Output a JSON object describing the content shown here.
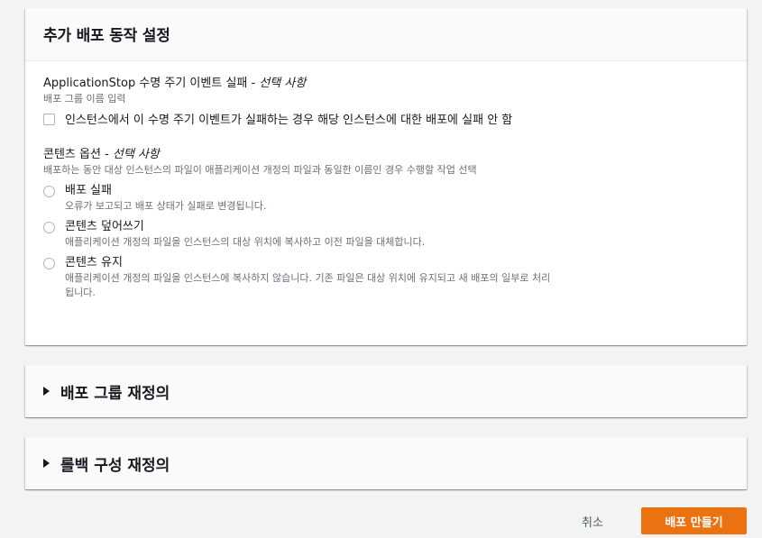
{
  "main_panel": {
    "title": "추가 배포 동작 설정",
    "app_stop": {
      "label": "ApplicationStop 수명 주기 이벤트 실패",
      "optional": "선택 사항",
      "desc": "배포 그룹 이름 입력",
      "checkbox_text": "인스턴스에서 이 수명 주기 이벤트가 실패하는 경우 해당 인스턴스에 대한 배포에 실패 안 함",
      "checked": false
    },
    "content_options": {
      "label": "콘텐츠 옵션",
      "optional": "선택 사항",
      "desc": "배포하는 동안 대상 인스턴스의 파일이 애플리케이션 개정의 파일과 동일한 이름인 경우 수행할 작업 선택",
      "options": [
        {
          "label": "배포 실패",
          "desc": "오류가 보고되고 배포 상태가 실패로 변경됩니다."
        },
        {
          "label": "콘텐츠 덮어쓰기",
          "desc": "애플리케이션 개정의 파일을 인스턴스의 대상 위치에 복사하고 이전 파일을 대체합니다."
        },
        {
          "label": "콘텐츠 유지",
          "desc": "애플리케이션 개정의 파일을 인스턴스에 복사하지 않습니다. 기존 파일은 대상 위치에 유지되고 새 배포의 일부로 처리됩니다."
        }
      ]
    }
  },
  "override_panel": {
    "title": "배포 그룹 재정의"
  },
  "rollback_panel": {
    "title": "롤백 구성 재정의"
  },
  "footer": {
    "cancel_label": "취소",
    "create_label": "배포 만들기"
  },
  "colors": {
    "primary_button": "#ec7211",
    "background": "#f2f3f3"
  }
}
